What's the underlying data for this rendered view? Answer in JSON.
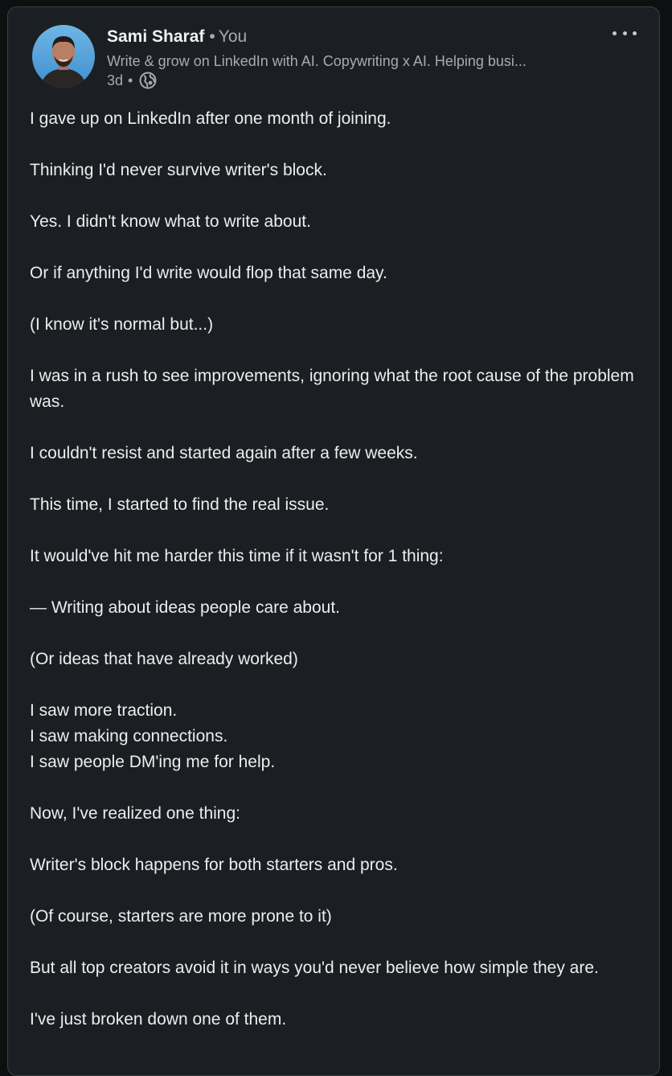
{
  "author": {
    "name": "Sami Sharaf",
    "relation": "You",
    "headline": "Write & grow on LinkedIn with AI. Copywriting x AI. Helping busi...",
    "time_ago": "3d",
    "visibility_icon": "globe-icon"
  },
  "more_icon": "ellipsis-icon",
  "post": {
    "paragraphs": [
      [
        "I gave up on LinkedIn after one month of joining."
      ],
      [
        "Thinking I'd never survive writer's block."
      ],
      [
        "Yes. I didn't know what to write about."
      ],
      [
        "Or if anything I'd write would flop that same day."
      ],
      [
        "(I know it's normal but...)"
      ],
      [
        "I was in a rush to see improvements, ignoring what the root cause of the problem was."
      ],
      [
        "I couldn't resist and started again after a few weeks."
      ],
      [
        "This time, I started to find the real issue."
      ],
      [
        "It would've hit me harder this time if it wasn't for 1 thing:"
      ],
      [
        "— Writing about ideas people care about."
      ],
      [
        "(Or ideas that have already worked)"
      ],
      [
        "I saw more traction.",
        "I saw making connections.",
        "I saw people DM'ing me for help."
      ],
      [
        "Now, I've realized one thing:"
      ],
      [
        "Writer's block happens for both starters and pros."
      ],
      [
        "(Of course, starters are more prone to it)"
      ],
      [
        "But all top creators avoid it in ways you'd never believe how simple they are."
      ],
      [
        "I've just broken down one of them."
      ]
    ]
  },
  "colors": {
    "card_background": "#1b1f23",
    "primary_text": "#eceded",
    "secondary_text": "#a8aaac"
  }
}
